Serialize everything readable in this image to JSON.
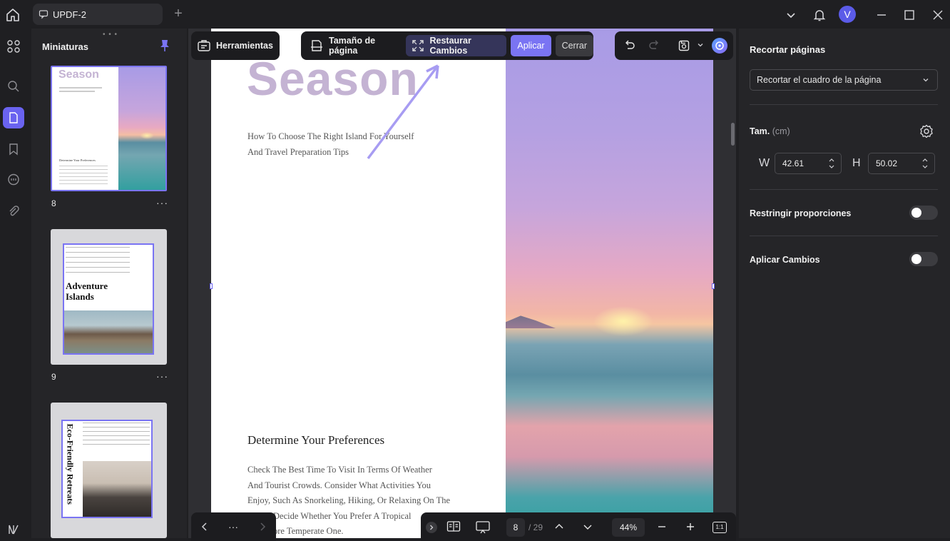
{
  "titlebar": {
    "tab_title": "UPDF-2",
    "tab_plus": "+",
    "avatar_letter": "V"
  },
  "thumbnails": {
    "title": "Miniaturas",
    "pages": [
      {
        "number": "8",
        "cover_title": "Season",
        "section": "Determine Your Preferences"
      },
      {
        "number": "9",
        "cover_title": "Adventure Islands"
      },
      {
        "number": "",
        "cover_title": "Eco-Friendly Retreats"
      }
    ],
    "more": "···"
  },
  "toolbar": {
    "tools_label": "Herramientas",
    "page_size_label": "Tamaño de página",
    "restore_label": "Restaurar Cambios",
    "apply_label": "Aplicar",
    "close_label": "Cerrar"
  },
  "document": {
    "title": "Season",
    "subtitle_line1": "How To Choose The Right Island For Yourself",
    "subtitle_line2": "And Travel Preparation Tips",
    "section_title": "Determine Your Preferences",
    "body_lines": [
      "Check The Best Time To Visit In Terms Of Weather",
      "And Tourist Crowds. Consider What Activities You",
      "Enjoy, Such As Snorkeling, Hiking, Or Relaxing On The",
      "Decide Whether You Prefer A Tropical",
      "ore Temperate One."
    ]
  },
  "bottombar": {
    "more": "···",
    "current_page": "8",
    "total_pages": "/ 29",
    "zoom": "44%",
    "fit_label": "1:1"
  },
  "crop_panel": {
    "title": "Recortar páginas",
    "select_value": "Recortar el cuadro de la página",
    "size_label": "Tam.",
    "size_unit": "(cm)",
    "width_label": "W",
    "width_value": "42.61",
    "height_label": "H",
    "height_value": "50.02",
    "constrain_label": "Restringir proporciones",
    "constrain_on": false,
    "apply_changes_label": "Aplicar Cambios",
    "apply_changes_on": false
  },
  "colors": {
    "accent": "#6a63f0",
    "apply_button": "#7a74f3",
    "panel_bg": "#252528",
    "canvas_bg": "#2f2f33"
  },
  "icons": [
    "home-icon",
    "chat-icon",
    "chevron-down-icon",
    "bell-icon",
    "minimize-icon",
    "maximize-icon",
    "close-icon",
    "grid-icon",
    "search-icon",
    "pages-icon",
    "bookmark-icon",
    "comment-icon",
    "attachment-icon",
    "pin-icon",
    "tools-icon",
    "page-size-icon",
    "expand-icon",
    "undo-icon",
    "redo-icon",
    "save-icon",
    "ai-icon",
    "settings-icon",
    "chevron-left-icon",
    "chevron-right-icon",
    "reader-icon",
    "presentation-icon",
    "arrow-up-icon",
    "arrow-down-icon",
    "zoom-out-icon",
    "zoom-in-icon",
    "pdf-logo-icon"
  ]
}
